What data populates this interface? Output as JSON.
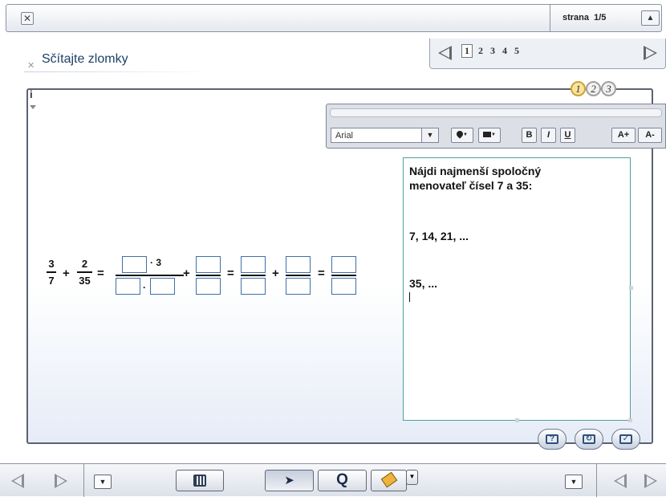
{
  "topbar": {
    "close_icon": "close-box-icon",
    "page_label": "strana  1/5",
    "up_icon": "triangle-up-icon"
  },
  "exercise": {
    "close_icon": "close-box-icon",
    "title": "Sčítajte zlomky"
  },
  "pagenav": {
    "prev_icon": "triangle-left-icon",
    "next_icon": "triangle-right-icon",
    "pages": [
      "1",
      "2",
      "3",
      "4",
      "5"
    ],
    "current": "1"
  },
  "frame": {
    "info_label": "i"
  },
  "steps": [
    "1",
    "2",
    "3"
  ],
  "editor_toolbar": {
    "font": "Arial",
    "buttons": {
      "text_color_icon": "text-color-icon",
      "bg_color_icon": "background-color-icon",
      "bold": "B",
      "italic": "I",
      "underline": "U",
      "increase": "A+",
      "decrease": "A-"
    }
  },
  "note": {
    "lines": [
      "Nájdi najmenší spoločný",
      "menovateľ čísel 7 a 35:",
      "7, 14, 21, ...",
      "35, ..."
    ]
  },
  "equation": {
    "frac1": {
      "num": "3",
      "den": "7"
    },
    "plus": "+",
    "frac2": {
      "num": "2",
      "den": "35"
    },
    "equals": "=",
    "times_three": "· 3",
    "times_dot": "·"
  },
  "actions": {
    "hint_icon": "hint-icon",
    "reset_icon": "reset-icon",
    "check_icon": "check-icon"
  },
  "bottombar": {
    "prev_icon": "triangle-left-icon",
    "next_icon": "triangle-right-icon",
    "menu_icon": "dropdown-icon",
    "calculator_icon": "calculator-icon",
    "pointer_icon": "pointer-icon",
    "zoom_icon": "magnifier-icon",
    "highlighter_icon": "highlighter-icon"
  }
}
